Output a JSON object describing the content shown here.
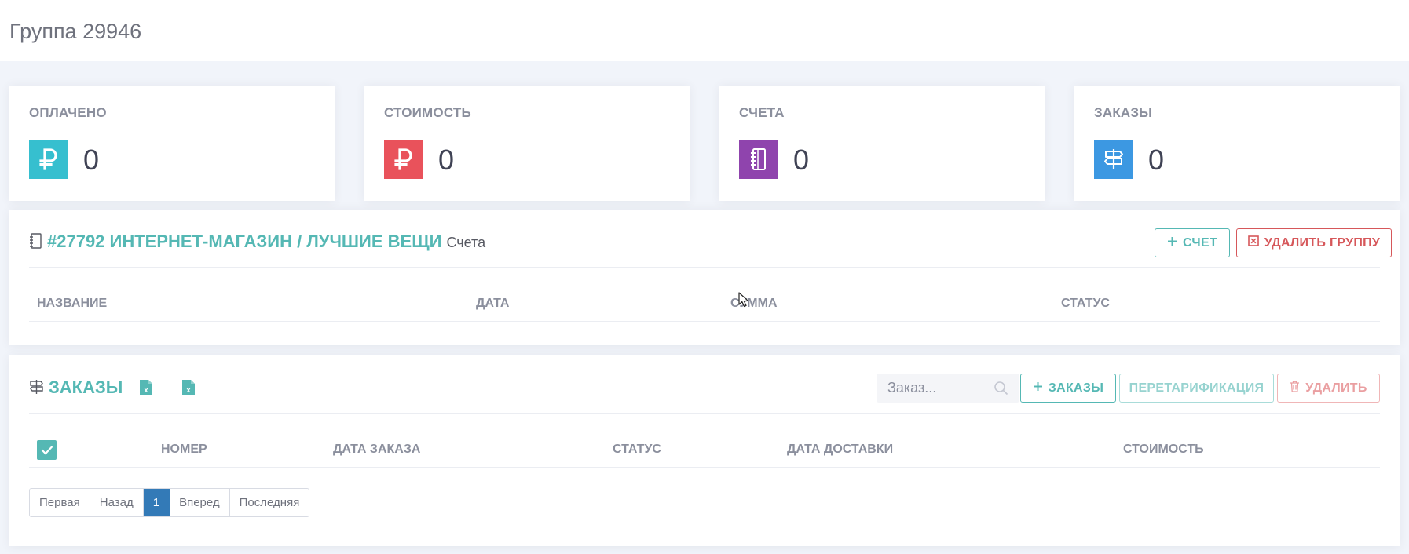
{
  "page": {
    "title": "Группа 29946"
  },
  "stats": [
    {
      "label": "ОПЛАЧЕНО",
      "value": "0",
      "icon": "ruble-icon",
      "color": "#36bfcf"
    },
    {
      "label": "СТОИМОСТЬ",
      "value": "0",
      "icon": "ruble-icon",
      "color": "#e9525b"
    },
    {
      "label": "СЧЕТА",
      "value": "0",
      "icon": "notebook-icon",
      "color": "#8f44ad"
    },
    {
      "label": "ЗАКАЗЫ",
      "value": "0",
      "icon": "signpost-icon",
      "color": "#3c98e2"
    }
  ],
  "invoices": {
    "icon": "notebook-icon",
    "title": "#27792 ИНТЕРНЕТ-МАГАЗИН / ЛУЧШИЕ ВЕЩИ",
    "subtitle": "Счета",
    "add_label": "СЧЕТ",
    "delete_group_label": "УДАЛИТЬ ГРУППУ",
    "columns": [
      "НАЗВАНИЕ",
      "ДАТА",
      "СУММА",
      "СТАТУС"
    ]
  },
  "orders": {
    "icon": "signpost-icon",
    "title": "ЗАКАЗЫ",
    "search_placeholder": "Заказ...",
    "add_label": "ЗАКАЗЫ",
    "retariff_label": "ПЕРЕТАРИФИКАЦИЯ",
    "delete_label": "УДАЛИТЬ",
    "columns": [
      "НОМЕР",
      "ДАТА ЗАКАЗА",
      "СТАТУС",
      "ДАТА ДОСТАВКИ",
      "СТОИМОСТЬ"
    ],
    "select_all_checked": true
  },
  "pagination": {
    "first": "Первая",
    "prev": "Назад",
    "current": "1",
    "next": "Вперед",
    "last": "Последняя"
  },
  "colors": {
    "accent": "#55b8b4",
    "danger": "#d6575a",
    "page_active": "#337ab7"
  }
}
